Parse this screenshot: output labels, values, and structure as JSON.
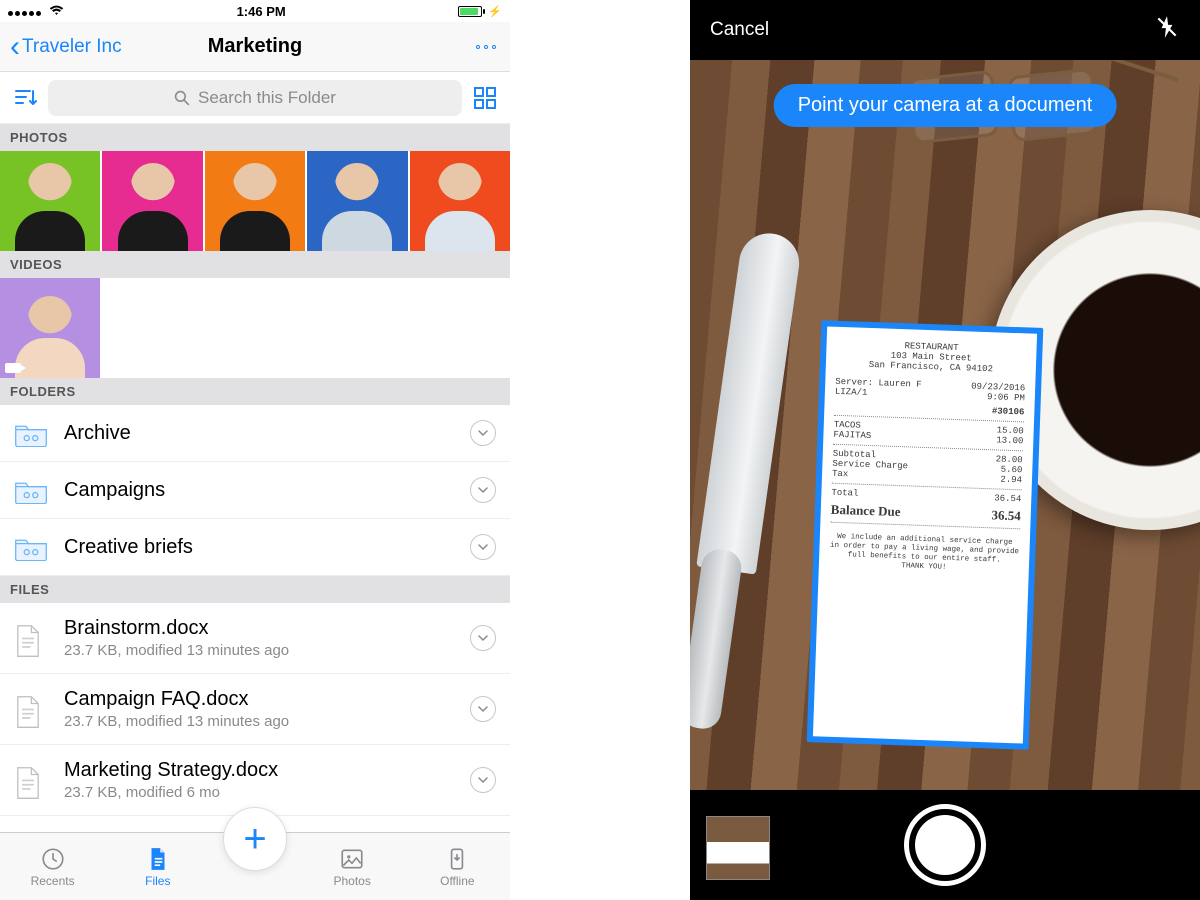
{
  "statusbar": {
    "time": "1:46 PM"
  },
  "nav": {
    "back_label": "Traveler Inc",
    "title": "Marketing"
  },
  "search": {
    "placeholder": "Search this Folder"
  },
  "sections": {
    "photos": "PHOTOS",
    "videos": "VIDEOS",
    "folders": "FOLDERS",
    "files": "FILES"
  },
  "photos": [
    {
      "bg": "#77c225",
      "shirt": "#1a1a1a"
    },
    {
      "bg": "#e62b91",
      "shirt": "#1a1a1a"
    },
    {
      "bg": "#f27b13",
      "shirt": "#1a1a1a"
    },
    {
      "bg": "#2b66c4",
      "shirt": "#cdd8e0"
    },
    {
      "bg": "#f04a1f",
      "shirt": "#dce5ee"
    }
  ],
  "videos": [
    {
      "bg": "#b58fe1",
      "shirt": "#f4d7c0"
    }
  ],
  "folders": [
    {
      "name": "Archive"
    },
    {
      "name": "Campaigns"
    },
    {
      "name": "Creative briefs"
    }
  ],
  "files": [
    {
      "name": "Brainstorm.docx",
      "meta": "23.7 KB, modified 13 minutes ago"
    },
    {
      "name": "Campaign FAQ.docx",
      "meta": "23.7 KB, modified 13 minutes ago"
    },
    {
      "name": "Marketing Strategy.docx",
      "meta": "23.7 KB, modified 6 mo"
    }
  ],
  "tabs": {
    "recents": "Recents",
    "files": "Files",
    "photos": "Photos",
    "offline": "Offline"
  },
  "camera": {
    "cancel": "Cancel",
    "hint": "Point your camera at a document"
  },
  "receipt": {
    "header1": "RESTAURANT",
    "header2": "103 Main Street",
    "header3": "San Francisco, CA 94102",
    "server_label": "Server: Lauren F",
    "server_sub": "LIZA/1",
    "date": "09/23/2016",
    "time": "9:06 PM",
    "ticket": "#30106",
    "items": [
      {
        "name": "TACOS",
        "price": "15.00"
      },
      {
        "name": "FAJITAS",
        "price": "13.00"
      }
    ],
    "subtotal_label": "Subtotal",
    "subtotal": "28.00",
    "service_label": "Service Charge",
    "service": "5.60",
    "tax_label": "Tax",
    "tax": "2.94",
    "total_label": "Total",
    "total": "36.54",
    "due_label": "Balance Due",
    "due": "36.54",
    "footer1": "We include an additional service charge",
    "footer2": "in order to pay a living wage, and provide",
    "footer3": "full benefits to our entire staff.",
    "footer4": "THANK YOU!"
  }
}
